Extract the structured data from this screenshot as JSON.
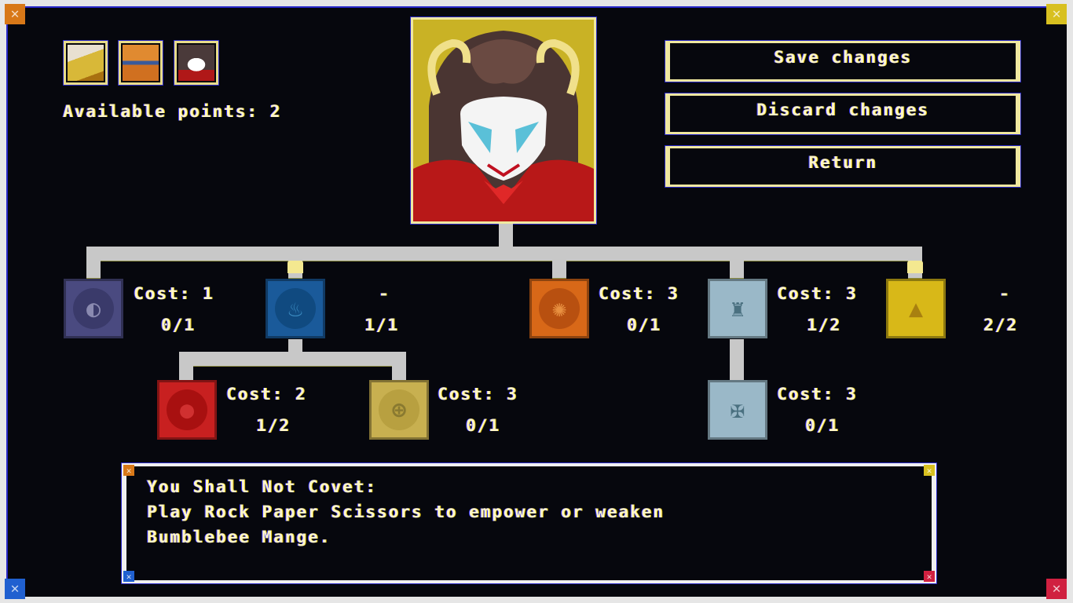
{
  "screen": "skill-tree",
  "party": [
    {
      "name": "party-member-1",
      "colors": [
        "#d8b838",
        "#e8e0d0"
      ]
    },
    {
      "name": "party-member-2",
      "colors": [
        "#d87820",
        "#f0a040"
      ]
    },
    {
      "name": "party-member-3",
      "colors": [
        "#5a3a30",
        "#ffffff"
      ],
      "selected": true
    }
  ],
  "available_points_label": "Available points: 2",
  "buttons": {
    "save": "Save changes",
    "discard": "Discard changes",
    "return": "Return"
  },
  "skills": [
    {
      "id": "skill-moon",
      "icon": "moon-icon",
      "color": "#4a4a80",
      "glyph": "◐",
      "cost": "Cost: 1",
      "progress": "0/1",
      "current": 0,
      "max": 1,
      "maxed": false
    },
    {
      "id": "skill-water",
      "icon": "flame-icon",
      "color": "#1a5a9a",
      "glyph": "♨",
      "cost": "-",
      "progress": "1/1",
      "current": 1,
      "max": 1,
      "maxed": true
    },
    {
      "id": "skill-fire",
      "icon": "drop-icon",
      "color": "#c82020",
      "glyph": "●",
      "cost": "Cost: 2",
      "progress": "1/2",
      "current": 1,
      "max": 2,
      "maxed": false
    },
    {
      "id": "skill-cross",
      "icon": "cross-circle-icon",
      "color": "#c8b050",
      "glyph": "⊕",
      "cost": "Cost: 3",
      "progress": "0/1",
      "current": 0,
      "max": 1,
      "maxed": false
    },
    {
      "id": "skill-ornament",
      "icon": "ornament-icon",
      "color": "#d86818",
      "glyph": "✺",
      "cost": "Cost: 3",
      "progress": "0/1",
      "current": 0,
      "max": 1,
      "maxed": false
    },
    {
      "id": "skill-tower",
      "icon": "tower-icon",
      "color": "#9ab8c8",
      "glyph": "♜",
      "cost": "Cost: 3",
      "progress": "1/2",
      "current": 1,
      "max": 2,
      "maxed": false
    },
    {
      "id": "skill-bee",
      "icon": "bee-icon",
      "color": "#d8b818",
      "glyph": "▲",
      "cost": "-",
      "progress": "2/2",
      "current": 2,
      "max": 2,
      "maxed": true
    },
    {
      "id": "skill-crosses",
      "icon": "triple-cross-icon",
      "color": "#9ab8c8",
      "glyph": "✠",
      "cost": "Cost: 3",
      "progress": "0/1",
      "current": 0,
      "max": 1,
      "maxed": false
    }
  ],
  "description": {
    "title": "You Shall Not Covet:",
    "line1": "Play Rock Paper Scissors to empower or weaken",
    "line2": "Bumblebee Mange."
  },
  "corner_colors": {
    "tl": "#d87818",
    "tr": "#d8c020",
    "bl": "#2060d0",
    "br": "#d02040"
  }
}
